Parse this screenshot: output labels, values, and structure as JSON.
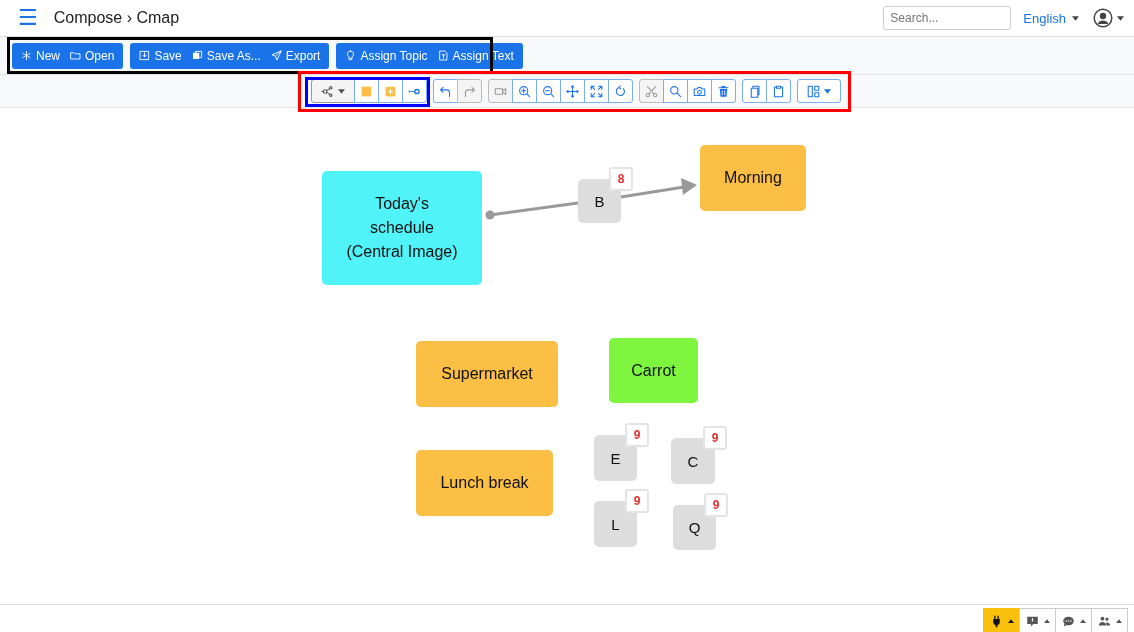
{
  "header": {
    "menu": "☰",
    "breadcrumb": "Compose › Cmap",
    "search": {
      "placeholder": "Search..."
    },
    "language": "English"
  },
  "file_toolbar": [
    {
      "buttons": [
        {
          "label": "New"
        },
        {
          "label": "Open"
        }
      ]
    },
    {
      "buttons": [
        {
          "label": "Save"
        },
        {
          "label": "Save As..."
        },
        {
          "label": "Export"
        }
      ]
    },
    {
      "buttons": [
        {
          "label": "Assign Topic"
        },
        {
          "label": "Assign Text"
        }
      ]
    }
  ],
  "edit_toolbar": [
    {
      "buttons": [
        {
          "kind": "dropdown",
          "disabled": false
        },
        {
          "kind": "button",
          "disabled": false
        },
        {
          "kind": "button",
          "disabled": false
        },
        {
          "kind": "button",
          "disabled": false
        }
      ]
    },
    {
      "buttons": [
        {
          "kind": "button",
          "disabled": false
        },
        {
          "kind": "button",
          "disabled": true
        }
      ]
    },
    {
      "buttons": [
        {
          "kind": "button",
          "disabled": true
        },
        {
          "kind": "button",
          "disabled": false
        },
        {
          "kind": "button",
          "disabled": false
        },
        {
          "kind": "button",
          "disabled": false
        },
        {
          "kind": "button",
          "disabled": false
        },
        {
          "kind": "button",
          "disabled": false
        }
      ]
    },
    {
      "buttons": [
        {
          "kind": "button",
          "disabled": true
        },
        {
          "kind": "button",
          "disabled": false
        },
        {
          "kind": "button",
          "disabled": false
        },
        {
          "kind": "button",
          "disabled": false
        }
      ]
    },
    {
      "buttons": [
        {
          "kind": "button",
          "disabled": false
        },
        {
          "kind": "button",
          "disabled": false
        }
      ]
    },
    {
      "buttons": [
        {
          "kind": "dropdown",
          "disabled": false
        }
      ]
    }
  ],
  "nodes": [
    {
      "kind": "concept",
      "label": "Today's schedule (Central Image)",
      "color": "#50f3f7"
    },
    {
      "kind": "marker",
      "label": "B",
      "count": "8"
    },
    {
      "kind": "concept",
      "label": "Morning",
      "color": "#fcbf45"
    },
    {
      "kind": "concept",
      "label": "Supermarket",
      "color": "#fcbf45"
    },
    {
      "kind": "concept",
      "label": "Carrot",
      "color": "#7ef53f"
    },
    {
      "kind": "concept",
      "label": "Lunch break",
      "color": "#fcbf45"
    },
    {
      "kind": "marker",
      "label": "E",
      "count": "9"
    },
    {
      "kind": "marker",
      "label": "C",
      "count": "9"
    },
    {
      "kind": "marker",
      "label": "L",
      "count": "9"
    },
    {
      "kind": "marker",
      "label": "Q",
      "count": "9"
    }
  ],
  "highlights": [
    {
      "color": "#000000"
    },
    {
      "color": "#ff0000"
    },
    {
      "color": "#0000ff"
    }
  ],
  "bottom_tabs": [
    {
      "selected": true
    },
    {
      "selected": false
    },
    {
      "selected": false
    },
    {
      "selected": false
    }
  ]
}
